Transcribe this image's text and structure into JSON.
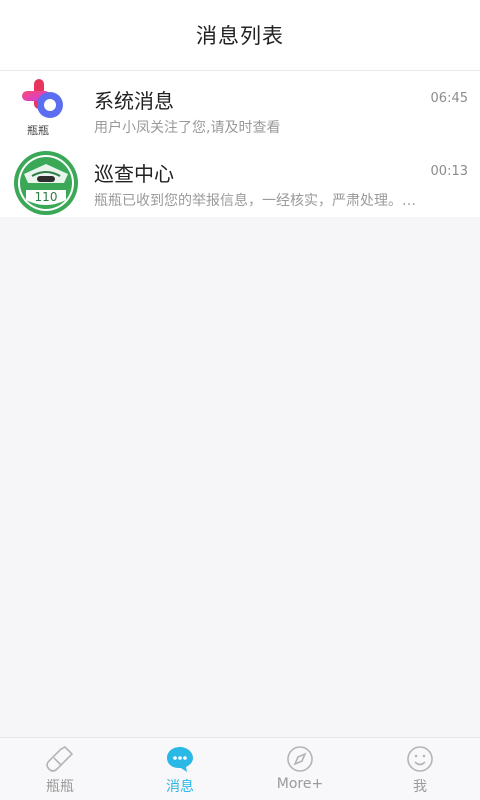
{
  "header": {
    "title": "消息列表"
  },
  "messages": [
    {
      "avatar_icon": "bottle-logo-icon",
      "avatar_label": "瓶瓶",
      "name": "系统消息",
      "time": "06:45",
      "preview": "用户小凤关注了您,请及时查看"
    },
    {
      "avatar_icon": "police-patrol-icon",
      "avatar_label": "110",
      "name": "巡查中心",
      "time": "00:13",
      "preview": "瓶瓶已收到您的举报信息，一经核实，严肃处理。…"
    }
  ],
  "tabs": [
    {
      "label": "瓶瓶",
      "icon": "bottle-icon",
      "active": false
    },
    {
      "label": "消息",
      "icon": "chat-bubble-icon",
      "active": true
    },
    {
      "label": "More+",
      "icon": "compass-icon",
      "active": false
    },
    {
      "label": "我",
      "icon": "smiley-icon",
      "active": false
    }
  ],
  "colors": {
    "accent": "#2ab8e6",
    "background": "#f6f5f8",
    "badge_green": "#3aa857"
  }
}
